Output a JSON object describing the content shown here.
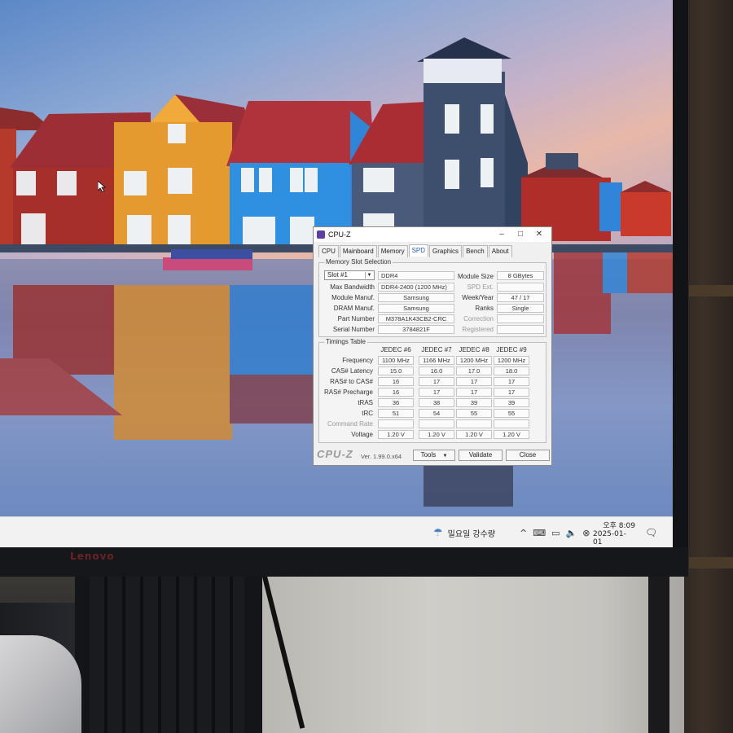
{
  "monitor": {
    "brand": "Lenovo"
  },
  "window": {
    "title": "CPU-Z",
    "controls": {
      "minimize": "–",
      "maximize": "□",
      "close": "✕"
    }
  },
  "tabs": [
    {
      "label": "CPU"
    },
    {
      "label": "Mainboard"
    },
    {
      "label": "Memory"
    },
    {
      "label": "SPD",
      "active": true
    },
    {
      "label": "Graphics"
    },
    {
      "label": "Bench"
    },
    {
      "label": "About"
    }
  ],
  "slot_group": {
    "title": "Memory Slot Selection",
    "slot_select": "Slot #1",
    "type": "DDR4",
    "labels": {
      "max_bandwidth": "Max Bandwidth",
      "module_manuf": "Module Manuf.",
      "dram_manuf": "DRAM Manuf.",
      "part_number": "Part Number",
      "serial_number": "Serial Number",
      "module_size": "Module Size",
      "spd_ext": "SPD Ext.",
      "week_year": "Week/Year",
      "ranks": "Ranks",
      "correction": "Correction",
      "registered": "Registered"
    },
    "values": {
      "max_bandwidth": "DDR4-2400 (1200 MHz)",
      "module_manuf": "Samsung",
      "dram_manuf": "Samsung",
      "part_number": "M378A1K43CB2-CRC",
      "serial_number": "3784821F",
      "module_size": "8 GBytes",
      "spd_ext": "",
      "week_year": "47 / 17",
      "ranks": "Single",
      "correction": "",
      "registered": ""
    }
  },
  "timings": {
    "title": "Timings Table",
    "columns": [
      "JEDEC #6",
      "JEDEC #7",
      "JEDEC #8",
      "JEDEC #9"
    ],
    "rows": [
      {
        "label": "Frequency",
        "values": [
          "1100 MHz",
          "1166 MHz",
          "1200 MHz",
          "1200 MHz"
        ]
      },
      {
        "label": "CAS# Latency",
        "values": [
          "15.0",
          "16.0",
          "17.0",
          "18.0"
        ]
      },
      {
        "label": "RAS# to CAS#",
        "values": [
          "16",
          "17",
          "17",
          "17"
        ]
      },
      {
        "label": "RAS# Precharge",
        "values": [
          "16",
          "17",
          "17",
          "17"
        ]
      },
      {
        "label": "tRAS",
        "values": [
          "36",
          "38",
          "39",
          "39"
        ]
      },
      {
        "label": "tRC",
        "values": [
          "51",
          "54",
          "55",
          "55"
        ]
      },
      {
        "label": "Command Rate",
        "dim": true,
        "values": [
          "",
          "",
          "",
          ""
        ]
      },
      {
        "label": "Voltage",
        "values": [
          "1.20 V",
          "1.20 V",
          "1.20 V",
          "1.20 V"
        ]
      }
    ]
  },
  "footer": {
    "logo": "CPU-Z",
    "version": "Ver. 1.99.0.x64",
    "tools": "Tools",
    "validate": "Validate",
    "close": "Close"
  },
  "taskbar": {
    "weather": "밀요일 강수량",
    "time": "오후 8:09",
    "date": "2025-01-01"
  },
  "colors": {
    "tab_active": "#2a56c6",
    "taskbar": "#f2f2f3"
  }
}
